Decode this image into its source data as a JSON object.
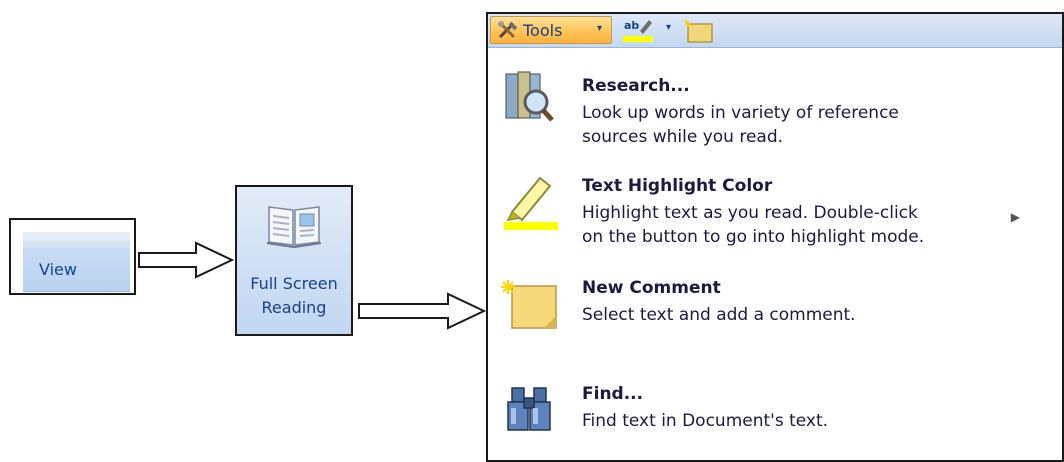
{
  "ribbon": {
    "view_tab_label": "View"
  },
  "full_screen_button": {
    "line1": "Full Screen",
    "line2": "Reading"
  },
  "toolbar": {
    "tools_label": "Tools",
    "tools_caret": "▾",
    "highlight_caret": "▾"
  },
  "menu": {
    "items": [
      {
        "title": "Research...",
        "description_line1": "Look up words in variety of reference",
        "description_line2": "sources while you read.",
        "icon": "research-icon"
      },
      {
        "title": "Text Highlight Color",
        "description_line1": "Highlight text as you read. Double-click",
        "description_line2": "on the button to go into highlight mode.",
        "icon": "highlighter-icon",
        "submenu_arrow": "▶"
      },
      {
        "title": "New Comment",
        "description_line1": "Select text and add a comment.",
        "icon": "new-comment-icon"
      },
      {
        "title": "Find...",
        "description_line1": "Find text in Document's text.",
        "icon": "binoculars-icon"
      }
    ]
  },
  "colors": {
    "ribbon_text": "#15428b",
    "menu_text": "#1a1a40",
    "tools_button": "#ffc35a",
    "highlight_yellow": "#ffff00"
  }
}
